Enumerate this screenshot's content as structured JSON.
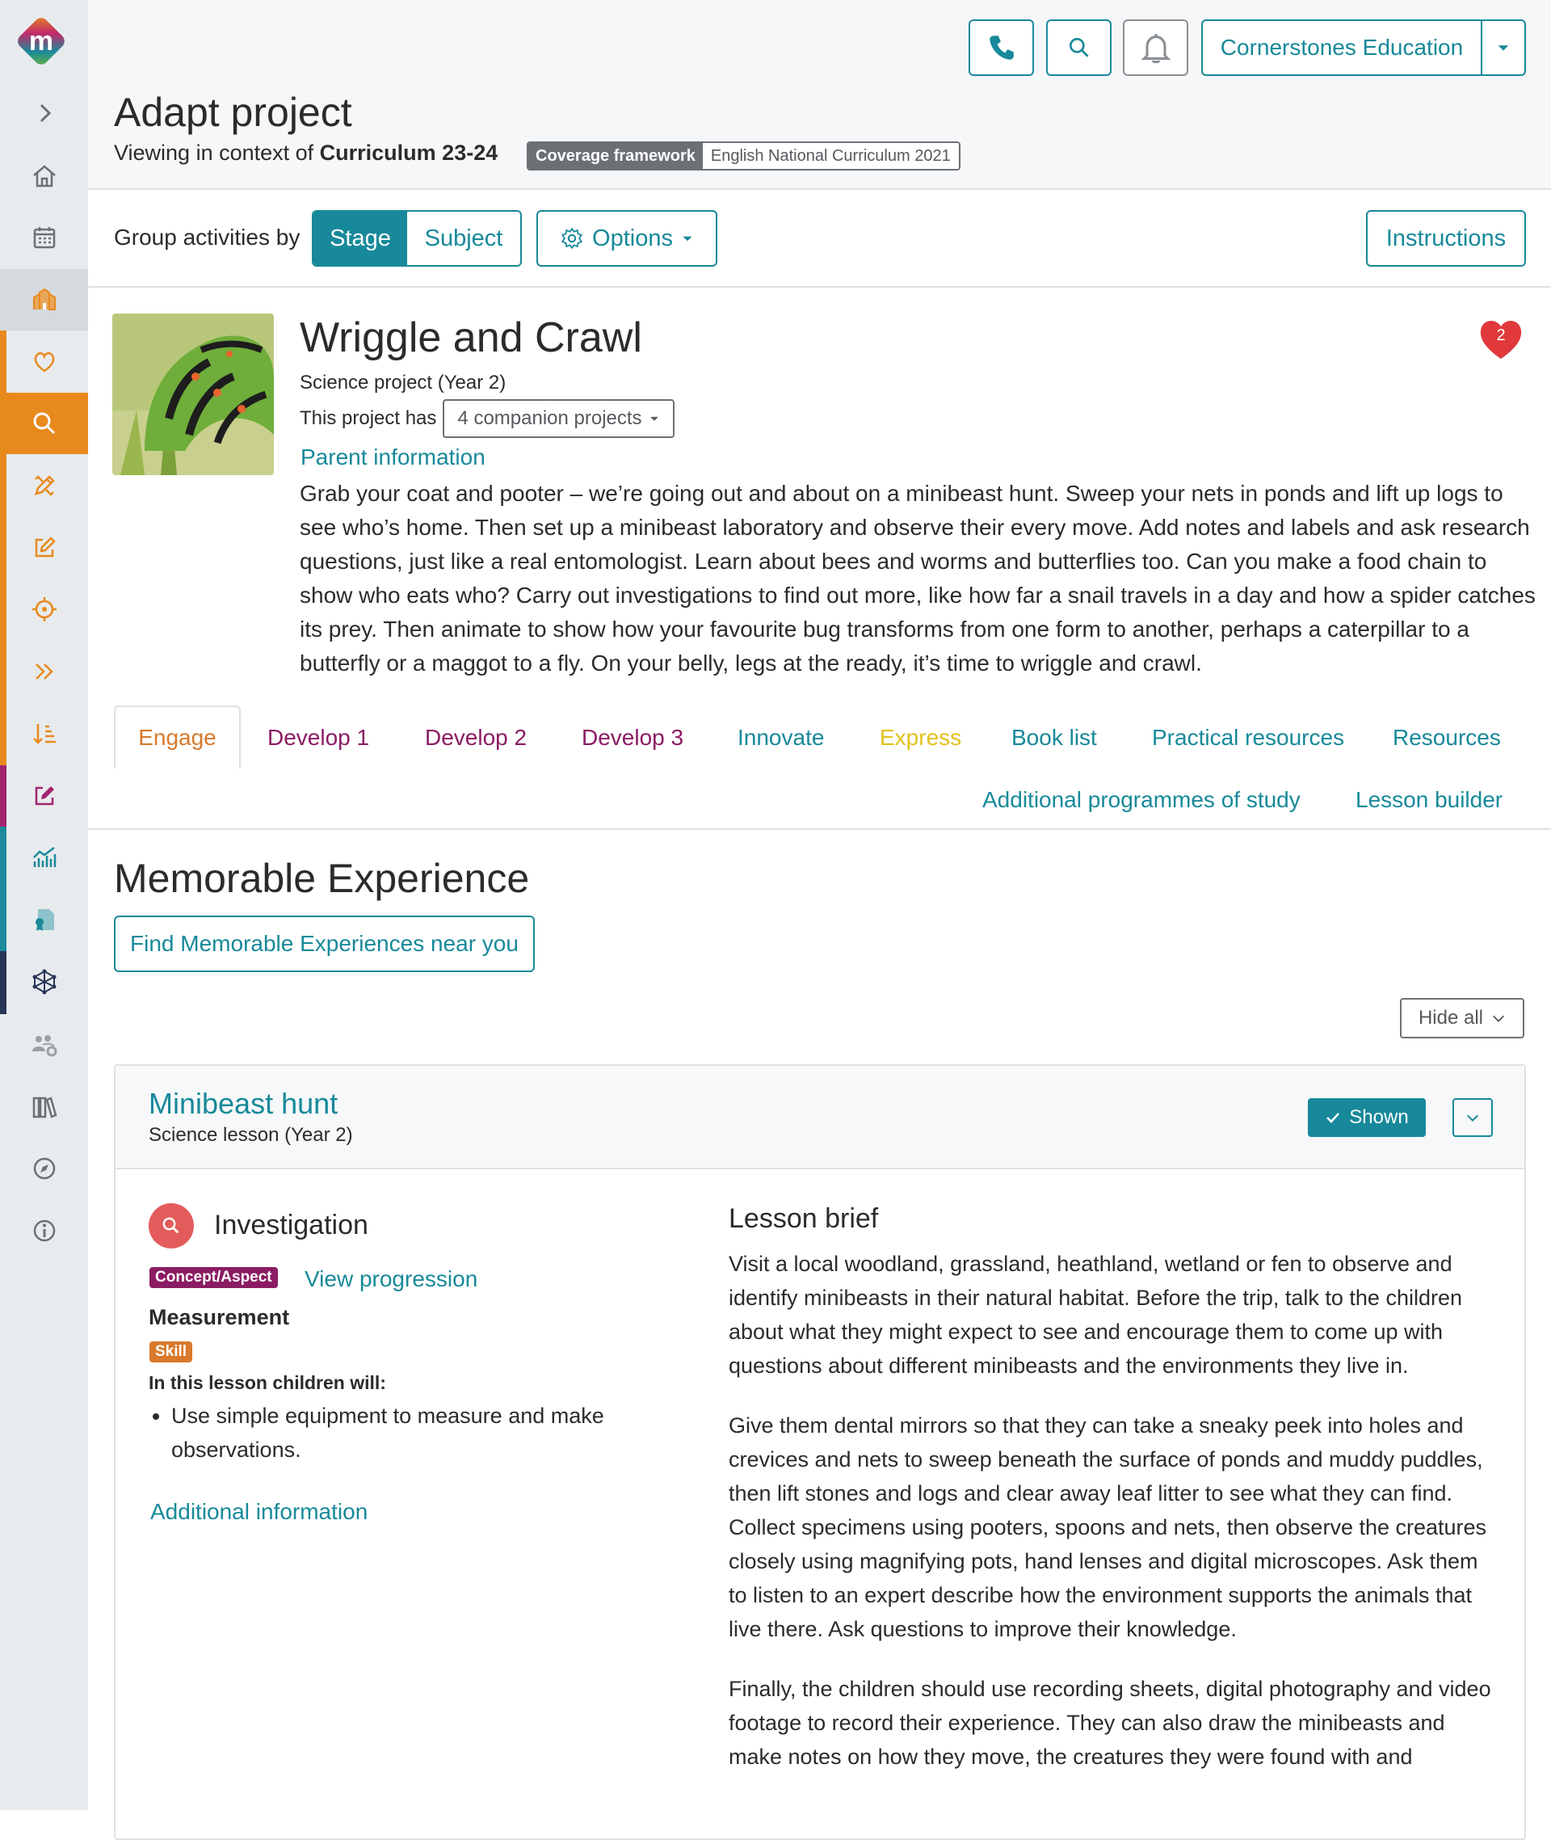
{
  "header": {
    "title": "Adapt project",
    "context_prefix": "Viewing in context of ",
    "context_value": "Curriculum 23-24",
    "coverage_key": "Coverage framework",
    "coverage_value": "English National Curriculum 2021",
    "school": "Cornerstones Education",
    "icons": [
      "phone-icon",
      "search-icon",
      "bell-icon",
      "chevron-down-icon"
    ]
  },
  "toolbar": {
    "group_label": "Group activities by",
    "stage": "Stage",
    "subject": "Subject",
    "options": "Options",
    "instructions": "Instructions"
  },
  "project": {
    "title": "Wriggle and Crawl",
    "subtitle": "Science project (Year 2)",
    "companion_label": "This project has",
    "companion_button": "4 companion projects",
    "parent_info": "Parent information",
    "favourites": "2",
    "description": "Grab your coat and pooter – we’re going out and about on a minibeast hunt. Sweep your nets in ponds and lift up logs to see who’s home. Then set up a minibeast laboratory and observe their every move. Add notes and labels and ask research questions, just like a real entomologist. Learn about bees and worms and butterflies too. Can you make a food chain to show who eats who? Carry out investigations to find out more, like how far a snail travels in a day and how a spider catches its prey. Then animate to show how your favourite bug transforms from one form to another, perhaps a caterpillar to a butterfly or a maggot to a fly. On your belly, legs at the ready, it’s time to wriggle and crawl."
  },
  "tabs": [
    {
      "label": "Engage",
      "color": "#d8792b"
    },
    {
      "label": "Develop 1",
      "color": "#8a1c63"
    },
    {
      "label": "Develop 2",
      "color": "#8a1c63"
    },
    {
      "label": "Develop 3",
      "color": "#8a1c63"
    },
    {
      "label": "Innovate",
      "color": "#17899a"
    },
    {
      "label": "Express",
      "color": "#e0c21d"
    },
    {
      "label": "Book list",
      "color": "#17899a"
    },
    {
      "label": "Practical resources",
      "color": "#17899a"
    },
    {
      "label": "Resources",
      "color": "#17899a"
    },
    {
      "label": "Additional programmes of study",
      "color": "#17899a"
    },
    {
      "label": "Lesson builder",
      "color": "#17899a"
    }
  ],
  "memorable": {
    "title": "Memorable Experience",
    "find_button": "Find Memorable Experiences near you",
    "hide_all": "Hide all"
  },
  "lesson": {
    "title": "Minibeast hunt",
    "subtitle": "Science lesson (Year 2)",
    "shown": "Shown",
    "category": "Investigation",
    "concept_pill": "Concept/Aspect",
    "view_progression": "View progression",
    "concept": "Measurement",
    "skill_pill": "Skill",
    "will_label": "In this lesson children will:",
    "objectives": [
      "Use simple equipment to measure and make observations."
    ],
    "additional_info": "Additional information",
    "brief_title": "Lesson brief",
    "brief": [
      "Visit a local woodland, grassland, heathland, wetland or fen to observe and identify minibeasts in their natural habitat. Before the trip, talk to the children about what they might expect to see and encourage them to come up with questions about different minibeasts and the environments they live in.",
      "Give them dental mirrors so that they can take a sneaky peek into holes and crevices and nets to sweep beneath the surface of ponds and muddy puddles, then lift stones and logs and clear away leaf litter to see what they can find. Collect specimens using pooters, spoons and nets, then observe the creatures closely using magnifying pots, hand lenses and digital microscopes. Ask them to listen to an expert describe how the environment supports the animals that live there. Ask questions to improve their knowledge.",
      "Finally, the children should use recording sheets, digital photography and video footage to record their experience. They can also draw the minibeasts and make notes on how they move, the creatures they were found with and"
    ]
  },
  "sidebar": {
    "items": [
      "logo-icon",
      "expand-icon",
      "home-icon",
      "calendar-icon",
      "school-icon",
      "heart-icon",
      "search-icon",
      "pencil-ruler-icon",
      "edit-icon",
      "target-icon",
      "fast-forward-icon",
      "sort-icon",
      "edit-square-icon",
      "chart-icon",
      "document-award-icon",
      "network-icon",
      "users-gear-icon",
      "library-icon",
      "compass-icon",
      "info-icon"
    ],
    "accent_orange": "#e8891d",
    "accent_magenta": "#a3246f",
    "accent_teal": "#1b8a9a",
    "accent_navy": "#273556"
  },
  "colors": {
    "teal": "#17899a",
    "magenta": "#8a1c63",
    "orange": "#d8792b",
    "red": "#e0383b"
  }
}
